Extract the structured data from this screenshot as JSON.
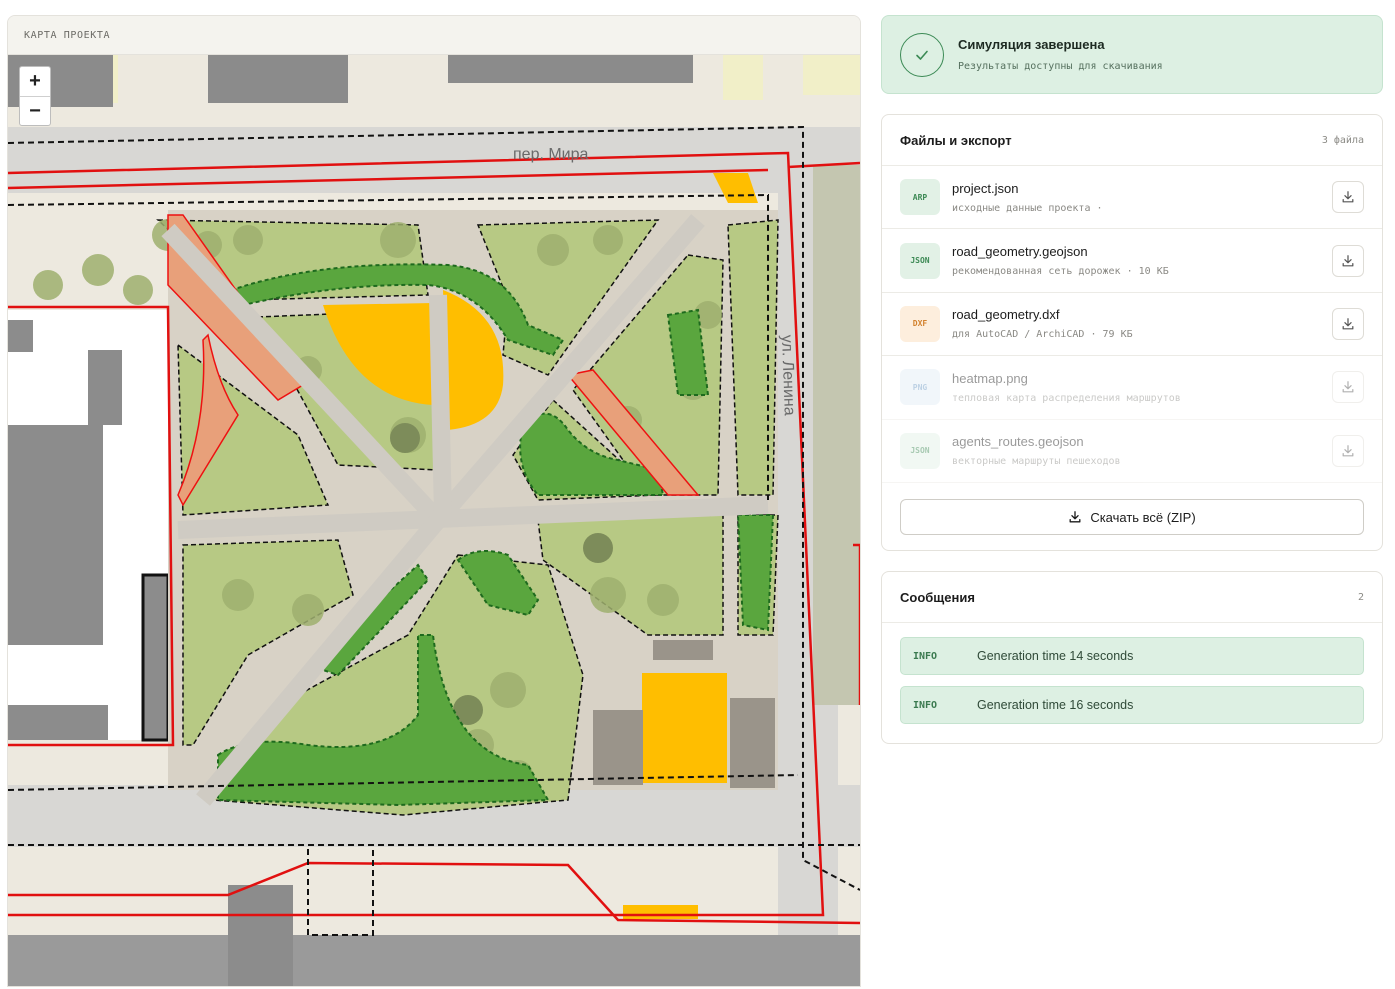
{
  "map": {
    "header": "КАРТА ПРОЕКТА",
    "zoom_in": "+",
    "zoom_out": "−",
    "street_mira": "пер. Мира",
    "street_lenina": "ул. Ленина"
  },
  "status": {
    "title": "Симуляция завершена",
    "subtitle": "Результаты доступны для скачивания",
    "icon": "check-icon"
  },
  "files": {
    "title": "Файлы и экспорт",
    "count": "3 файла",
    "items": [
      {
        "tag": "ARP",
        "name": "project.json",
        "desc": "исходные данные проекта ·",
        "enabled": true,
        "tag_bg": "#e2f1e6",
        "tag_fg": "#3d8a55"
      },
      {
        "tag": "JSON",
        "name": "road_geometry.geojson",
        "desc": "рекомендованная сеть дорожек · 10 КБ",
        "enabled": true,
        "tag_bg": "#e2f1e6",
        "tag_fg": "#3d8a55"
      },
      {
        "tag": "DXF",
        "name": "road_geometry.dxf",
        "desc": "для AutoCAD / ArchiCAD · 79 КБ",
        "enabled": true,
        "tag_bg": "#fdeedd",
        "tag_fg": "#d2822e"
      },
      {
        "tag": "PNG",
        "name": "heatmap.png",
        "desc": "тепловая карта распределения маршрутов",
        "enabled": false,
        "tag_bg": "#e1ecf6",
        "tag_fg": "#6f9bc4"
      },
      {
        "tag": "JSON",
        "name": "agents_routes.geojson",
        "desc": "векторные маршруты пешеходов",
        "enabled": false,
        "tag_bg": "#e2f1e6",
        "tag_fg": "#3d8a55"
      }
    ],
    "download_all": "Скачать всё (ZIP)"
  },
  "messages": {
    "title": "Сообщения",
    "count": "2",
    "items": [
      {
        "level": "INFO",
        "text": "Generation time 14 seconds"
      },
      {
        "level": "INFO",
        "text": "Generation time 16 seconds"
      }
    ]
  }
}
